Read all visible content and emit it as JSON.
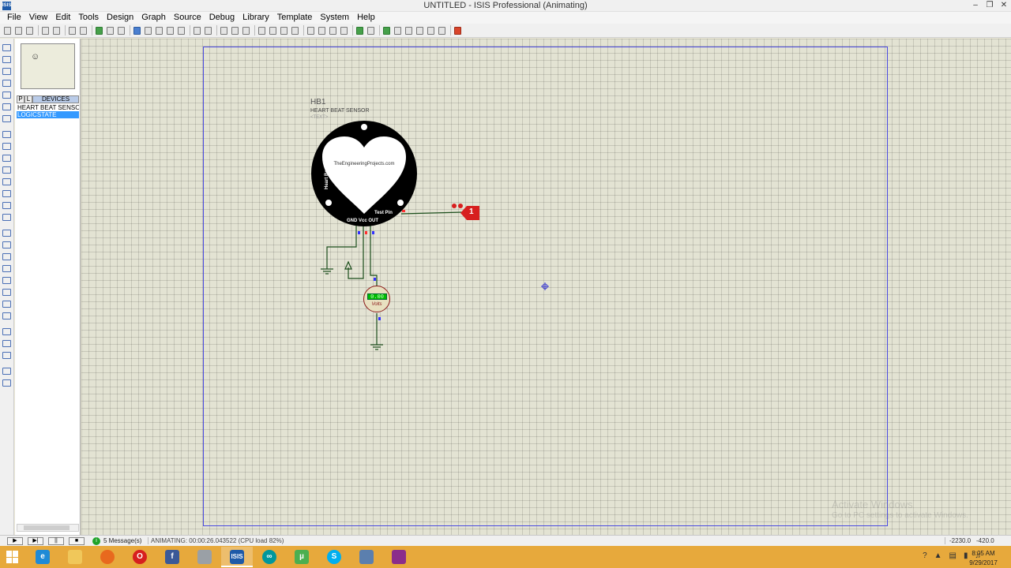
{
  "window": {
    "title": "UNTITLED - ISIS Professional (Animating)",
    "app_icon": "ISIS",
    "buttons": [
      "minimize-icon",
      "restore-icon",
      "close-icon"
    ]
  },
  "menu": [
    "File",
    "View",
    "Edit",
    "Tools",
    "Design",
    "Graph",
    "Source",
    "Debug",
    "Library",
    "Template",
    "System",
    "Help"
  ],
  "device_panel": {
    "tab_p": "P",
    "tab_l": "L",
    "title": "DEVICES",
    "items": [
      {
        "label": "HEART BEAT SENSOR",
        "selected": false
      },
      {
        "label": "LOGICSTATE",
        "selected": true
      }
    ]
  },
  "schematic": {
    "component_ref": "HB1",
    "component_name": "HEART BEAT SENSOR",
    "component_text": "<TEXT>",
    "sensor_site": "TheEngineeringProjects.com",
    "sensor_side_label": "Heart Beat Sensor",
    "sensor_pins": "GND Vcc OUT",
    "sensor_test_pin": "Test Pin",
    "logic_state_value": "1",
    "voltmeter_reading": "0.00",
    "voltmeter_unit": "Volts"
  },
  "watermark": {
    "line1": "Activate Windows",
    "line2": "Go to PC settings to activate Windows."
  },
  "status": {
    "play_icon": "▶",
    "step_icon": "▶|",
    "pause_icon": "||",
    "stop_icon": "■",
    "messages_icon": "i",
    "messages": "5 Message(s)",
    "animating": "ANIMATING: 00:00:26.043522 (CPU load 82%)",
    "coord_x": "-2230.0",
    "coord_y": "-420.0"
  },
  "taskbar": {
    "apps": [
      "Internet Explorer",
      "File Explorer",
      "Firefox",
      "Opera",
      "Facebook",
      "Settings",
      "ISIS",
      "Arduino",
      "uTorrent",
      "Skype",
      "Recycle",
      "WinRAR"
    ],
    "isis_label": "ISIS",
    "arduino_label": "∞",
    "utorrent_label": "µ",
    "skype_label": "S",
    "facebook_label": "f",
    "ie_label": "e",
    "opera_label": "O",
    "time": "8:05 AM",
    "date": "9/29/2017"
  },
  "colors": {
    "taskbar": "#e7a93c",
    "canvas": "#e3e3d3",
    "sheet_border": "#4a4ae0",
    "selection": "#3399ff",
    "logic_probe": "#d71f1f"
  }
}
